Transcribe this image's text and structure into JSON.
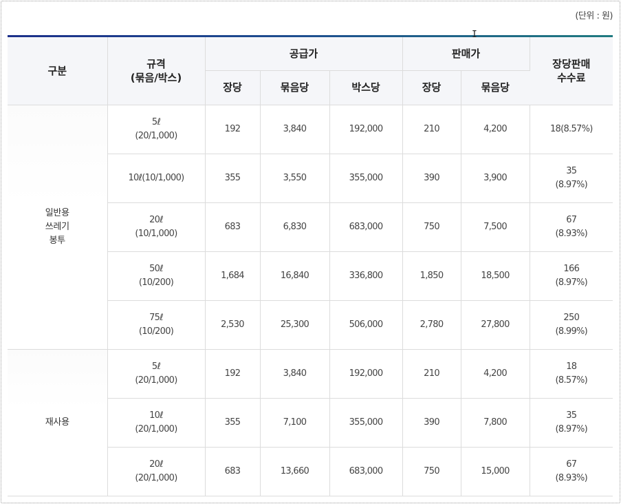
{
  "unit_label": "(단위 : 원)",
  "header": {
    "category": "구분",
    "spec_line1": "규격",
    "spec_line2": "(묶음/박스)",
    "supply_price": "공급가",
    "sale_price": "판매가",
    "fee_line1": "장당판매",
    "fee_line2": "수수료",
    "per_sheet": "장당",
    "per_bundle": "묶음당",
    "per_box": "박스당",
    "per_sheet_sale": "장당",
    "per_bundle_sale": "묶음당"
  },
  "groups": [
    {
      "name_lines": [
        "일반용",
        "쓰레기",
        "봉투"
      ],
      "rows": [
        {
          "spec": [
            "5ℓ",
            "(20/1,000)"
          ],
          "supply_sheet": "192",
          "supply_bundle": "3,840",
          "supply_box": "192,000",
          "sale_sheet": "210",
          "sale_bundle": "4,200",
          "fee": [
            "18(8.57%)"
          ]
        },
        {
          "spec": [
            "10ℓ(10/1,000)"
          ],
          "supply_sheet": "355",
          "supply_bundle": "3,550",
          "supply_box": "355,000",
          "sale_sheet": "390",
          "sale_bundle": "3,900",
          "fee": [
            "35",
            "(8.97%)"
          ]
        },
        {
          "spec": [
            "20ℓ",
            "(10/1,000)"
          ],
          "supply_sheet": "683",
          "supply_bundle": "6,830",
          "supply_box": "683,000",
          "sale_sheet": "750",
          "sale_bundle": "7,500",
          "fee": [
            "67",
            "(8.93%)"
          ]
        },
        {
          "spec": [
            "50ℓ",
            "(10/200)"
          ],
          "supply_sheet": "1,684",
          "supply_bundle": "16,840",
          "supply_box": "336,800",
          "sale_sheet": "1,850",
          "sale_bundle": "18,500",
          "fee": [
            "166",
            "(8.97%)"
          ]
        },
        {
          "spec": [
            "75ℓ",
            "(10/200)"
          ],
          "supply_sheet": "2,530",
          "supply_bundle": "25,300",
          "supply_box": "506,000",
          "sale_sheet": "2,780",
          "sale_bundle": "27,800",
          "fee": [
            "250",
            "(8.99%)"
          ]
        }
      ]
    },
    {
      "name_lines": [
        "재사용"
      ],
      "rows": [
        {
          "spec": [
            "5ℓ",
            "(20/1,000)"
          ],
          "supply_sheet": "192",
          "supply_bundle": "3,840",
          "supply_box": "192,000",
          "sale_sheet": "210",
          "sale_bundle": "4,200",
          "fee": [
            "18",
            "(8.57%)"
          ]
        },
        {
          "spec": [
            "10ℓ",
            "(20/1,000)"
          ],
          "supply_sheet": "355",
          "supply_bundle": "7,100",
          "supply_box": "355,000",
          "sale_sheet": "390",
          "sale_bundle": "7,800",
          "fee": [
            "35",
            "(8.97%)"
          ]
        },
        {
          "spec": [
            "20ℓ",
            "(20/1,000)"
          ],
          "supply_sheet": "683",
          "supply_bundle": "13,660",
          "supply_box": "683,000",
          "sale_sheet": "750",
          "sale_bundle": "15,000",
          "fee": [
            "67",
            "(8.93%)"
          ]
        }
      ]
    }
  ],
  "colors": {
    "header_bar_start": "#1b2f8a",
    "header_bar_end": "#1f7a80",
    "header_bg": "#f5f6f9",
    "grid_line": "#dcdcdc"
  },
  "icons": {
    "cursor": "text-cursor-icon"
  }
}
